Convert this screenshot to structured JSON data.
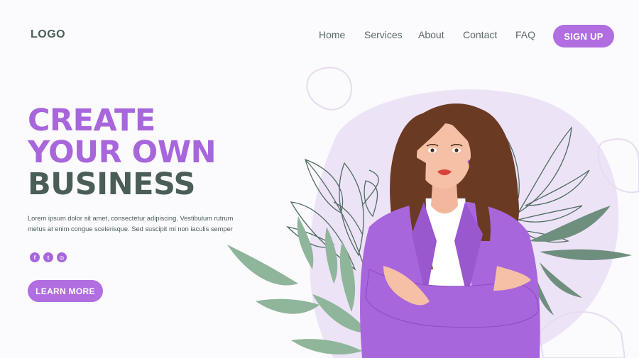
{
  "header": {
    "logo": "LOGO",
    "nav": [
      {
        "id": "home",
        "label": "Home"
      },
      {
        "id": "services",
        "label": "Services"
      },
      {
        "id": "about",
        "label": "About"
      },
      {
        "id": "contact",
        "label": "Contact"
      },
      {
        "id": "faq",
        "label": "FAQ"
      }
    ],
    "signup_label": "SIGN UP"
  },
  "hero": {
    "line1": "CREATE",
    "line2": "YOUR OWN",
    "line3": "BUSINESS",
    "body_line1": "Lorem ipsum dolor sit amet, consectetur adipiscing. Vestibulum rutrum",
    "body_line2": "metus at enim congue scelerisque. Sed suscipit mi non iaculis semper",
    "cta_label": "LEARN MORE"
  },
  "social": [
    {
      "id": "facebook",
      "glyph": "f",
      "icon": "facebook-icon"
    },
    {
      "id": "twitter",
      "glyph": "t",
      "icon": "twitter-icon"
    },
    {
      "id": "instagram",
      "glyph": "◎",
      "icon": "instagram-icon"
    }
  ],
  "colors": {
    "accent": "#b06ee0",
    "dark_green": "#4a5e57",
    "leaf_green": "#8fb59a",
    "blob_lavender": "#ede3f7",
    "jacket": "#a866dc",
    "hair": "#6b3a22"
  }
}
